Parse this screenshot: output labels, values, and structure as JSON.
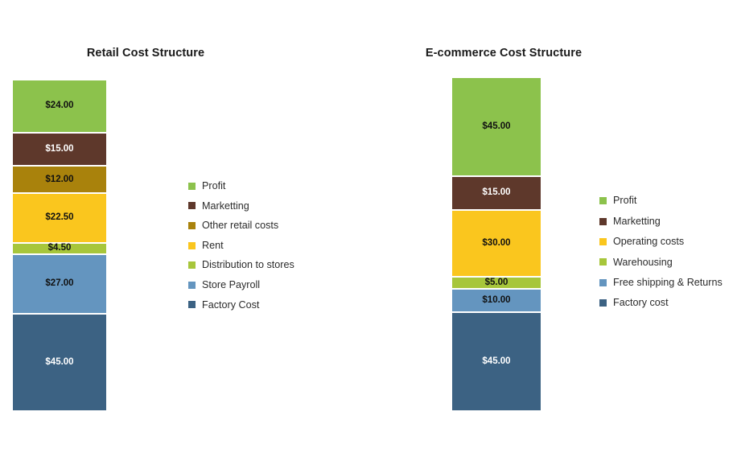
{
  "chart_data": [
    {
      "type": "bar",
      "title": "Retail Cost Structure",
      "subtitle": "",
      "xlabel": "",
      "ylabel": "",
      "stacked": true,
      "orientation": "vertical",
      "grid": false,
      "legend_position": "right",
      "ylim": [
        0,
        150
      ],
      "total": 150.0,
      "categories": [
        "Retail"
      ],
      "value_format": "$0.00",
      "segments": [
        {
          "label": "Profit",
          "value": 24.0,
          "display": "$24.00",
          "color": "#8CC24C",
          "label_color": "dark"
        },
        {
          "label": "Marketting",
          "value": 15.0,
          "display": "$15.00",
          "color": "#5E382B",
          "label_color": "light"
        },
        {
          "label": "Other retail costs",
          "value": 12.0,
          "display": "$12.00",
          "color": "#A9820C",
          "label_color": "dark"
        },
        {
          "label": "Rent",
          "value": 22.5,
          "display": "$22.50",
          "color": "#FAC61E",
          "label_color": "dark"
        },
        {
          "label": "Distribution to stores",
          "value": 4.5,
          "display": "$4.50",
          "color": "#A7C63B",
          "label_color": "dark"
        },
        {
          "label": "Store Payroll",
          "value": 27.0,
          "display": "$27.00",
          "color": "#6495BF",
          "label_color": "dark"
        },
        {
          "label": "Factory Cost",
          "value": 45.0,
          "display": "$45.00",
          "color": "#3C6283",
          "label_color": "light"
        }
      ],
      "legend": [
        {
          "label": "Profit",
          "color": "#8CC24C"
        },
        {
          "label": "Marketting",
          "color": "#5E382B"
        },
        {
          "label": "Other retail costs",
          "color": "#A9820C"
        },
        {
          "label": "Rent",
          "color": "#FAC61E"
        },
        {
          "label": "Distribution to stores",
          "color": "#A7C63B"
        },
        {
          "label": "Store Payroll",
          "color": "#6495BF"
        },
        {
          "label": "Factory Cost",
          "color": "#3C6283"
        }
      ]
    },
    {
      "type": "bar",
      "title": "E-commerce Cost Structure",
      "subtitle": "",
      "xlabel": "",
      "ylabel": "",
      "stacked": true,
      "orientation": "vertical",
      "grid": false,
      "legend_position": "right",
      "ylim": [
        0,
        150
      ],
      "total": 150.0,
      "categories": [
        "E-commerce"
      ],
      "value_format": "$0.00",
      "segments": [
        {
          "label": "Profit",
          "value": 45.0,
          "display": "$45.00",
          "color": "#8CC24C",
          "label_color": "dark"
        },
        {
          "label": "Marketting",
          "value": 15.0,
          "display": "$15.00",
          "color": "#5E382B",
          "label_color": "light"
        },
        {
          "label": "Operating costs",
          "value": 30.0,
          "display": "$30.00",
          "color": "#FAC61E",
          "label_color": "dark"
        },
        {
          "label": "Warehousing",
          "value": 5.0,
          "display": "$5.00",
          "color": "#A7C63B",
          "label_color": "dark"
        },
        {
          "label": "Free shipping & Returns",
          "value": 10.0,
          "display": "$10.00",
          "color": "#6495BF",
          "label_color": "dark"
        },
        {
          "label": "Factory cost",
          "value": 45.0,
          "display": "$45.00",
          "color": "#3C6283",
          "label_color": "light"
        }
      ],
      "legend": [
        {
          "label": "Profit",
          "color": "#8CC24C"
        },
        {
          "label": "Marketting",
          "color": "#5E382B"
        },
        {
          "label": "Operating costs",
          "color": "#FAC61E"
        },
        {
          "label": "Warehousing",
          "color": "#A7C63B"
        },
        {
          "label": "Free shipping & Returns",
          "color": "#6495BF"
        },
        {
          "label": "Factory cost",
          "color": "#3C6283"
        }
      ]
    }
  ]
}
